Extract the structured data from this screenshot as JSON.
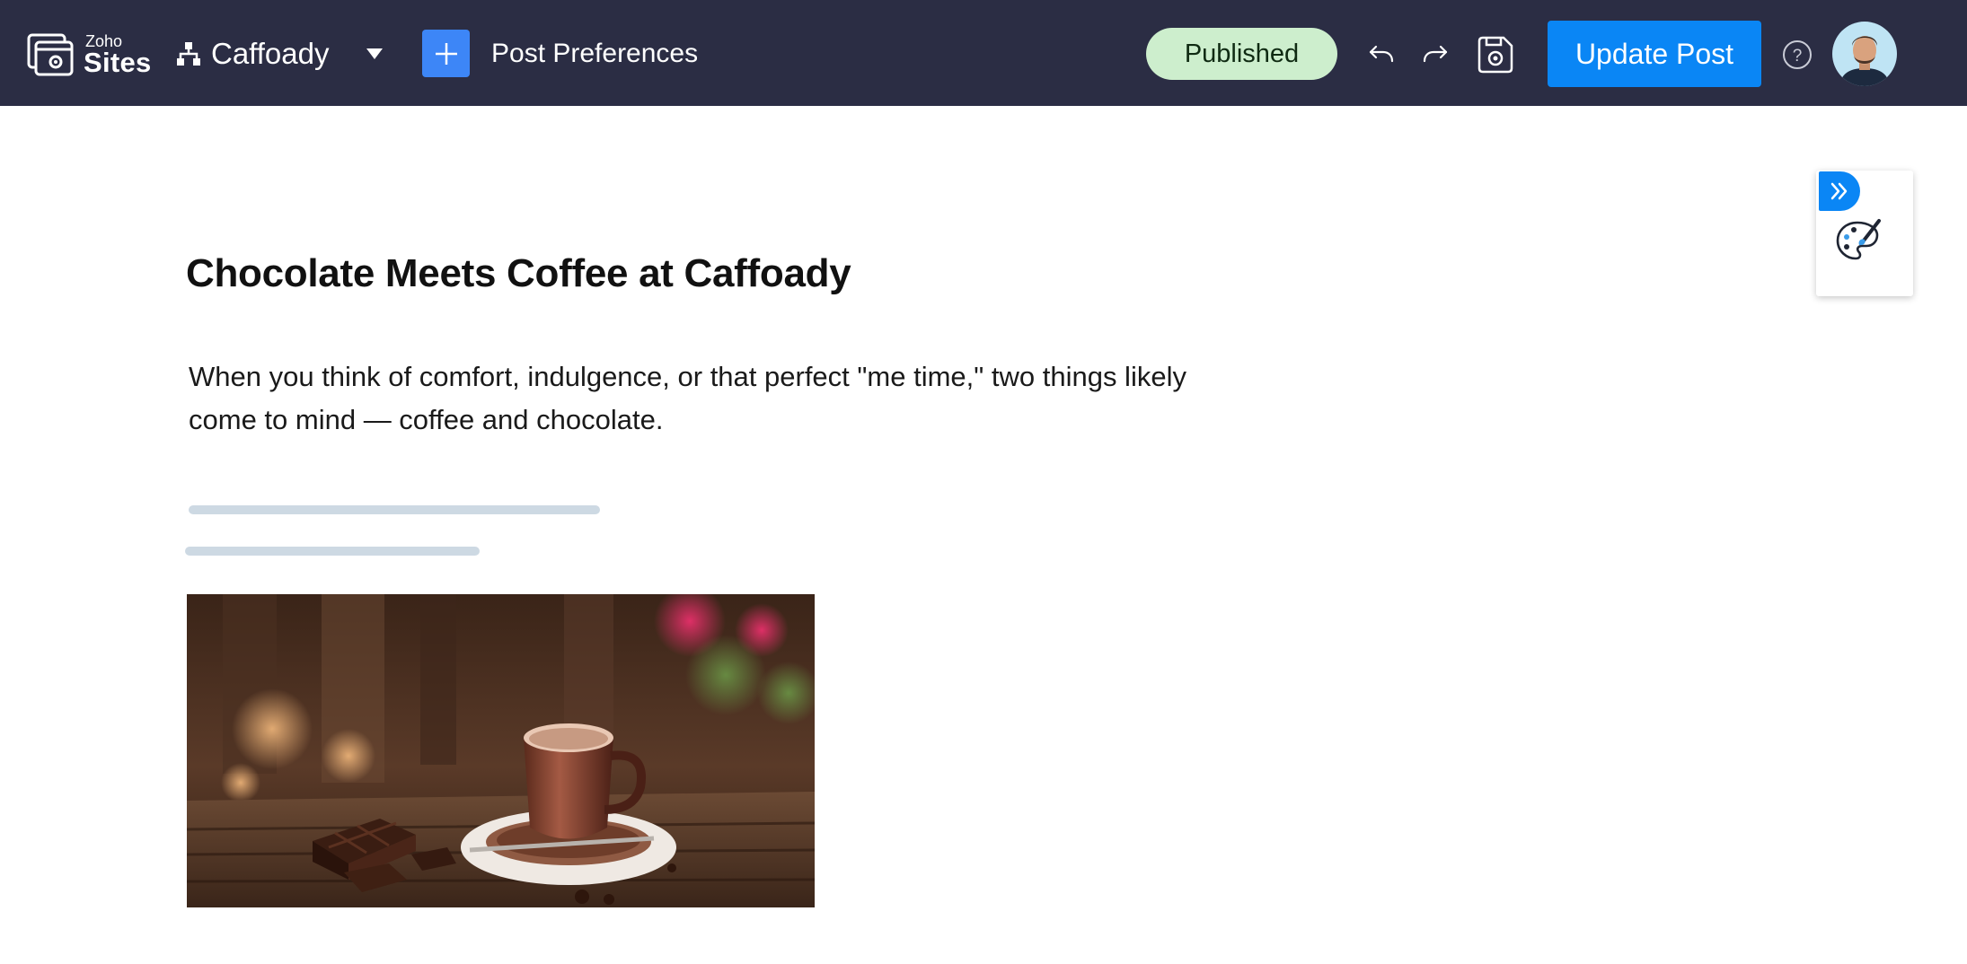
{
  "header": {
    "brand_small": "Zoho",
    "brand_big": "Sites",
    "site_name": "Caffoady",
    "post_preferences_label": "Post Preferences",
    "status_label": "Published",
    "update_button_label": "Update Post",
    "icons": [
      "sites-logo-icon",
      "sitemap-icon",
      "chevron-down-icon",
      "plus-icon",
      "undo-icon",
      "redo-icon",
      "save-icon",
      "help-icon",
      "avatar"
    ]
  },
  "post": {
    "title": "Chocolate Meets Coffee at Caffoady",
    "body": "When you think of comfort, indulgence, or that perfect \"me time,\" two things likely come to mind — coffee and chocolate.",
    "image_alt": "coffee cup with chocolate"
  },
  "side_panel": {
    "icons": [
      "double-chevron-right-icon",
      "paint-palette-icon"
    ]
  },
  "colors": {
    "topbar": "#2b2d44",
    "accent": "#0a86f5",
    "add_button": "#3d86f7",
    "published_bg": "#cdeecd",
    "placeholder": "#cdd9e3"
  }
}
